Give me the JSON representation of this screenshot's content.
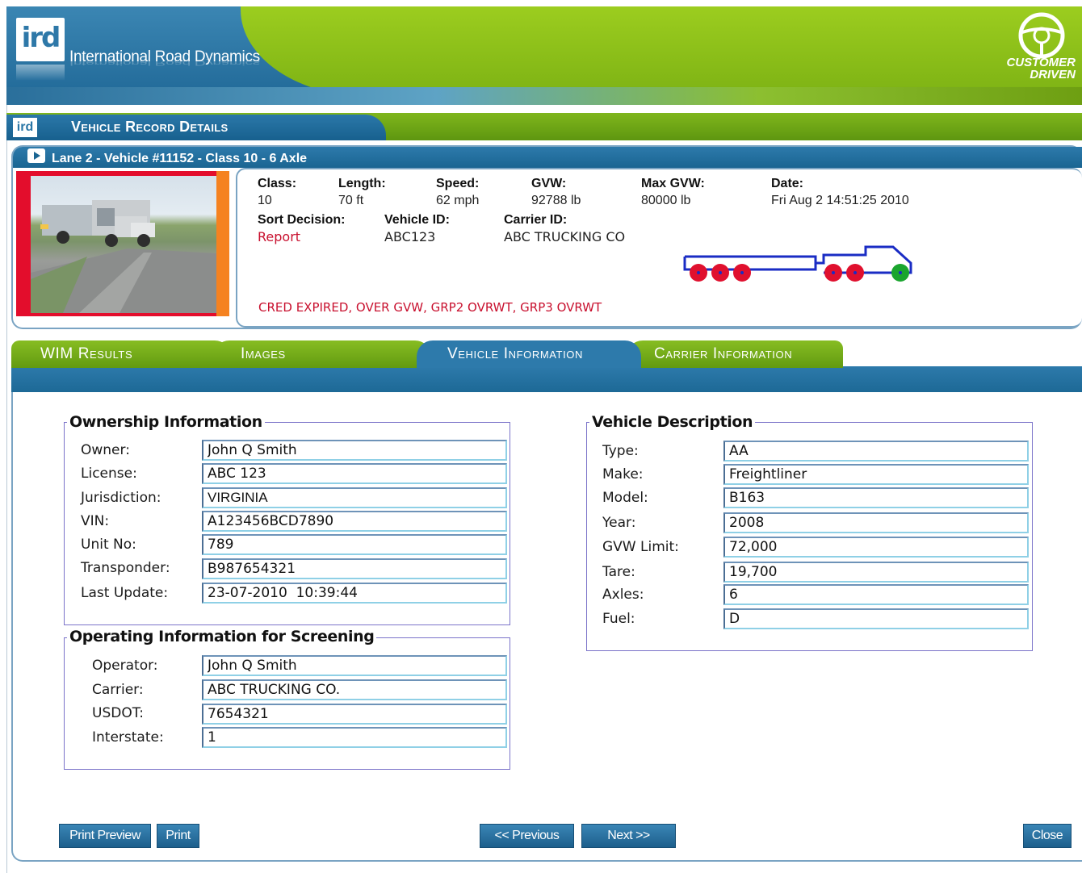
{
  "header": {
    "logo_text": "ird",
    "company_name": "International Road Dynamics",
    "badge_line1": "CUSTOMER",
    "badge_line2": "DRIVEN"
  },
  "title_bar": {
    "icon_text": "ird",
    "title": "Vehicle Record Details"
  },
  "vehicle_panel": {
    "heading": "Lane 2 - Vehicle #11152 - Class 10 - 6 Axle",
    "class_label": "Class:",
    "class_value": "10",
    "length_label": "Length:",
    "length_value": "70 ft",
    "speed_label": "Speed:",
    "speed_value": "62 mph",
    "gvw_label": "GVW:",
    "gvw_value": "92788 lb",
    "max_gvw_label": "Max GVW:",
    "max_gvw_value": "80000 lb",
    "date_label": "Date:",
    "date_value": "Fri Aug 2 14:51:25 2010",
    "sort_decision_label": "Sort Decision:",
    "sort_decision_value": "Report",
    "vehicle_id_label": "Vehicle ID:",
    "vehicle_id_value": "ABC123",
    "carrier_id_label": "Carrier ID:",
    "carrier_id_value": "ABC TRUCKING CO",
    "alerts": "CRED EXPIRED, OVER GVW, GRP2 OVRWT, GRP3 OVRWT",
    "axle_colors": [
      "#e0102e",
      "#e0102e",
      "#e0102e",
      "#e0102e",
      "#e0102e",
      "#1aa52e"
    ]
  },
  "tabs": [
    {
      "label": "WIM Results",
      "active": false
    },
    {
      "label": "Images",
      "active": false
    },
    {
      "label": "Vehicle Information",
      "active": true
    },
    {
      "label": "Carrier Information",
      "active": false
    }
  ],
  "ownership": {
    "legend": "Ownership Information",
    "fields": [
      {
        "label": "Owner:",
        "value": "John Q Smith"
      },
      {
        "label": "License:",
        "value": "ABC 123"
      },
      {
        "label": "Jurisdiction:",
        "value": "VIRGINIA"
      },
      {
        "label": "VIN:",
        "value": "A123456BCD7890"
      },
      {
        "label": "Unit No:",
        "value": "789"
      },
      {
        "label": "Transponder:",
        "value": "B987654321"
      },
      {
        "label": "Last Update:",
        "value": "23-07-2010  10:39:44"
      }
    ]
  },
  "operating": {
    "legend": "Operating Information for Screening",
    "fields": [
      {
        "label": "Operator:",
        "value": "John Q Smith"
      },
      {
        "label": "Carrier:",
        "value": "ABC TRUCKING CO."
      },
      {
        "label": "USDOT:",
        "value": "7654321"
      },
      {
        "label": "Interstate:",
        "value": "1"
      }
    ]
  },
  "description": {
    "legend": "Vehicle Description",
    "fields": [
      {
        "label": "Type:",
        "value": "AA"
      },
      {
        "label": "Make:",
        "value": "Freightliner"
      },
      {
        "label": "Model:",
        "value": "B163"
      },
      {
        "label": "Year:",
        "value": "2008"
      },
      {
        "label": "GVW Limit:",
        "value": "72,000"
      },
      {
        "label": "Tare:",
        "value": "19,700"
      },
      {
        "label": "Axles:",
        "value": "6"
      },
      {
        "label": "Fuel:",
        "value": "D"
      }
    ]
  },
  "buttons": {
    "print_preview": "Print Preview",
    "print": "Print",
    "previous": "<< Previous",
    "next": "Next >>",
    "close": "Close"
  },
  "colors": {
    "brand_blue": "#1f6796",
    "brand_green": "#7db214",
    "alert_red": "#c8102e"
  }
}
